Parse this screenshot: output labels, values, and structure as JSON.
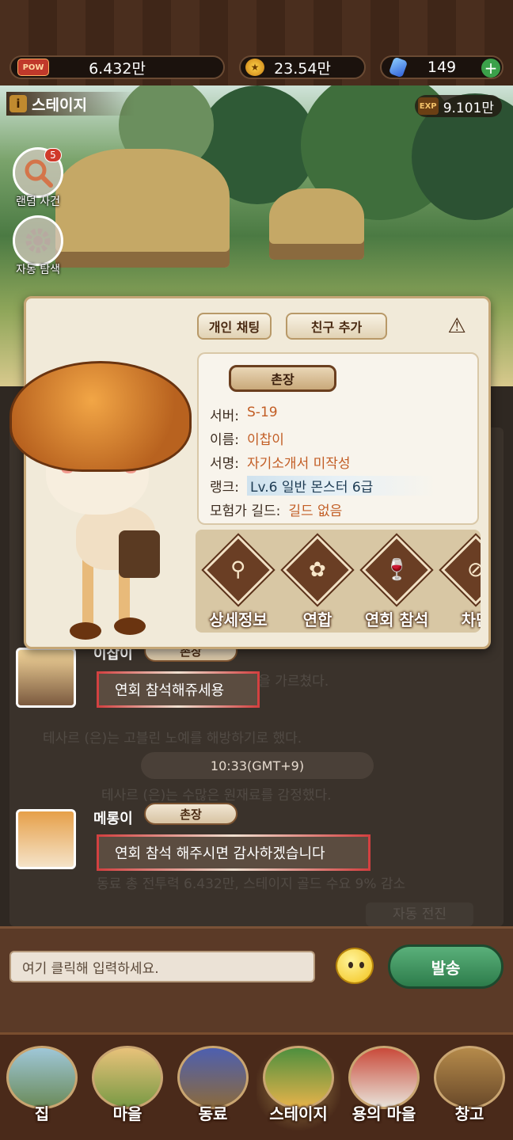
{
  "topbar": {
    "pow_icon": "POW",
    "pow_value": "6.432만",
    "gold_value": "23.54만",
    "gem_value": "149",
    "plus_label": "+"
  },
  "stage": {
    "title": "스테이지",
    "info_icon": "i",
    "exp_icon": "EXP",
    "exp_value": "9.101만",
    "random_event_label": "랜덤 사건",
    "random_event_badge": "5",
    "auto_explore_label": "자동 탐색"
  },
  "popup": {
    "private_chat": "개인 채팅",
    "add_friend": "친구 추가",
    "warn_icon": "⚠",
    "role": "촌장",
    "rows": {
      "server_label": "서버:",
      "server_value": "S-19",
      "name_label": "이름:",
      "name_value": "이찹이",
      "sign_label": "서명:",
      "sign_value": "자기소개서 미작성",
      "rank_label": "랭크:",
      "rank_value": "Lv.6 일반 몬스터 6급",
      "guild_label": "모험가 길드:",
      "guild_value": "길드 없음"
    },
    "actions": [
      {
        "label": "상세정보",
        "icon": "search-icon",
        "glyph": "⚲"
      },
      {
        "label": "연합",
        "icon": "rose-icon",
        "glyph": "✿"
      },
      {
        "label": "연회 참석",
        "icon": "wine-glasses-icon",
        "glyph": "🍷"
      },
      {
        "label": "차단",
        "icon": "block-icon",
        "glyph": "⊘"
      }
    ]
  },
  "chat": {
    "faint_1": "테사르 (은)는 고블린 노예를 해방하기로 했다.",
    "faint_2": "테사르 (은)는 수많은 원재료를 감정했다.",
    "faint_3": "동료 총 전투력 6.432만, 스테이지 골드 수요 9% 감소",
    "faint_4": "자동 전진",
    "faint_5": "...을 가르쳤다.",
    "time": "10:33(GMT+9)",
    "messages": [
      {
        "name": "이찹이",
        "title": "촌장",
        "text": "연회 참석해쥬세용"
      },
      {
        "name": "메롱이",
        "title": "촌장",
        "text": "연회 참석 해주시면 감사하겠습니다"
      }
    ]
  },
  "input": {
    "placeholder": "여기 클릭해 입력하세요.",
    "send": "발송"
  },
  "nav": {
    "items": [
      {
        "label": "집",
        "icon": "house-icon"
      },
      {
        "label": "마을",
        "icon": "village-icon"
      },
      {
        "label": "동료",
        "icon": "companions-icon"
      },
      {
        "label": "스테이지",
        "icon": "stage-icon"
      },
      {
        "label": "용의 마을",
        "icon": "dragon-village-icon"
      },
      {
        "label": "창고",
        "icon": "warehouse-icon"
      }
    ],
    "active_index": 3
  }
}
